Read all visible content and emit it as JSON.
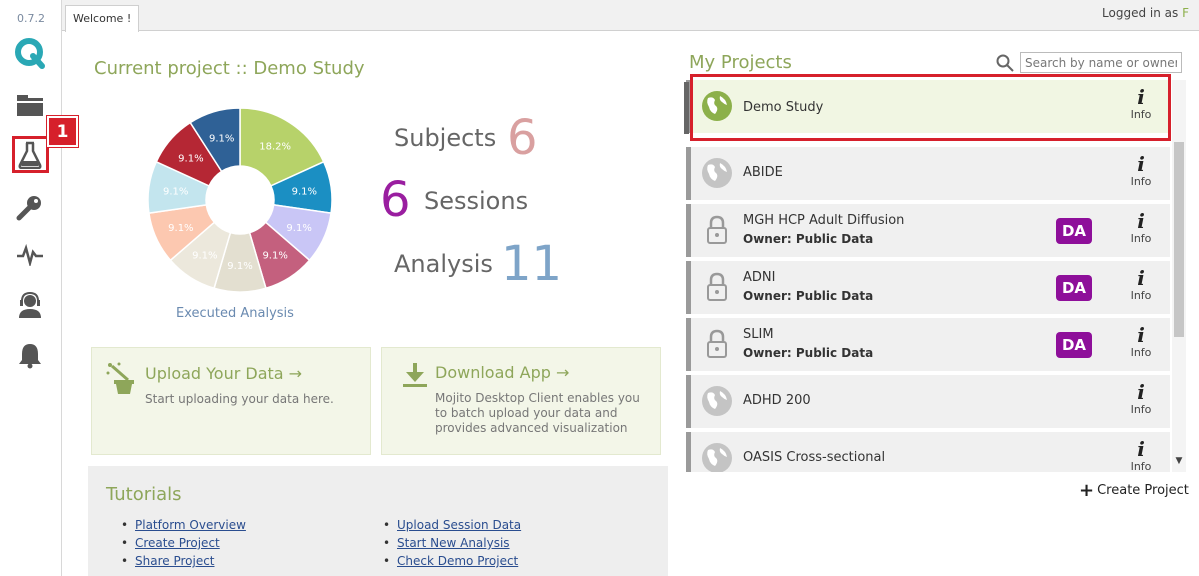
{
  "app": {
    "version": "0.7.2"
  },
  "sidebar": {
    "items": [
      {
        "name": "logo-icon"
      },
      {
        "name": "folder-icon"
      },
      {
        "name": "flask-icon"
      },
      {
        "name": "key-icon"
      },
      {
        "name": "pulse-icon"
      },
      {
        "name": "support-icon"
      },
      {
        "name": "bell-icon"
      }
    ],
    "annotation_badge": "1"
  },
  "tabs": [
    {
      "label": "Welcome !"
    }
  ],
  "header": {
    "logged_in_prefix": "Logged in as",
    "user_fragment": "F"
  },
  "current_project": {
    "title": "Current project :: Demo Study",
    "chart_caption": "Executed Analysis"
  },
  "stats": {
    "subjects_label": "Subjects",
    "subjects_value": "6",
    "sessions_label": "Sessions",
    "sessions_value": "6",
    "analysis_label": "Analysis",
    "analysis_value": "11"
  },
  "cards": {
    "upload": {
      "title": "Upload Your Data →",
      "text": "Start uploading your data here."
    },
    "download": {
      "title": "Download App →",
      "line1": "Mojito Desktop Client enables you",
      "line2": "to batch upload your data and",
      "line3": "provides advanced visualization"
    }
  },
  "tutorials": {
    "title": "Tutorials",
    "links": [
      "Platform Overview",
      "Create Project",
      "Share Project",
      "Upload Session Data",
      "Start New Analysis",
      "Check Demo Project"
    ]
  },
  "projects": {
    "title": "My Projects",
    "search_placeholder": "Search by name or owner",
    "info_label": "Info",
    "info_glyph": "i",
    "owner_da_badge": "DA",
    "create_label": "Create Project",
    "items": [
      {
        "name": "Demo Study",
        "owner": ""
      },
      {
        "name": "ABIDE",
        "owner": ""
      },
      {
        "name": "MGH HCP Adult Diffusion",
        "owner": "Owner: Public Data"
      },
      {
        "name": "ADNI",
        "owner": "Owner: Public Data"
      },
      {
        "name": "SLIM",
        "owner": "Owner: Public Data"
      },
      {
        "name": "ADHD 200",
        "owner": ""
      },
      {
        "name": "OASIS Cross-sectional",
        "owner": ""
      }
    ]
  },
  "chart_data": {
    "type": "pie",
    "title": "",
    "caption": "Executed Analysis",
    "slices": [
      {
        "label": "18.2%",
        "value": 18.2,
        "color": "#b7d26a"
      },
      {
        "label": "9.1%",
        "value": 9.1,
        "color": "#1b8fc3"
      },
      {
        "label": "9.1%",
        "value": 9.1,
        "color": "#c9c6f6"
      },
      {
        "label": "9.1%",
        "value": 9.1,
        "color": "#c4607e"
      },
      {
        "label": "9.1%",
        "value": 9.1,
        "color": "#e3dfd0"
      },
      {
        "label": "9.1%",
        "value": 9.1,
        "color": "#ece8dc"
      },
      {
        "label": "9.1%",
        "value": 9.1,
        "color": "#fcc8b0"
      },
      {
        "label": "9.1%",
        "value": 9.1,
        "color": "#c3e5ee"
      },
      {
        "label": "9.1%",
        "value": 9.1,
        "color": "#b52734"
      },
      {
        "label": "9.1%",
        "value": 9.1,
        "color": "#2f6196"
      }
    ]
  },
  "colors": {
    "accent_green": "#8ea65a",
    "annotation_red": "#d6202b",
    "subjects_color": "#d9a0a0",
    "sessions_color": "#9a1ea0",
    "analysis_color": "#7ea4c8",
    "da_purple": "#8e0f9a"
  }
}
